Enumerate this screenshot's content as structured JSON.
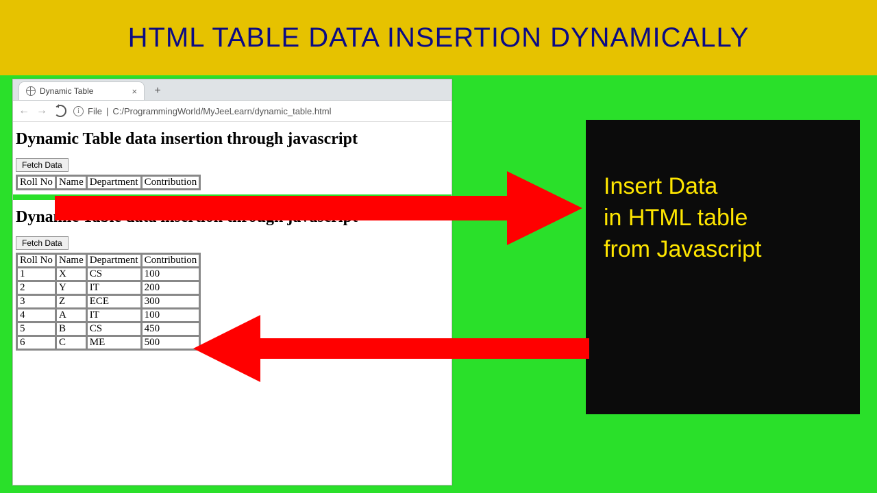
{
  "banner": {
    "title": "HTML TABLE DATA INSERTION DYNAMICALLY"
  },
  "browser": {
    "tab_title": "Dynamic Table",
    "url_scheme": "File",
    "url_path": "C:/ProgrammingWorld/MyJeeLearn/dynamic_table.html"
  },
  "page_top": {
    "heading": "Dynamic Table data insertion through javascript",
    "button": "Fetch Data",
    "headers": [
      "Roll No",
      "Name",
      "Department",
      "Contribution"
    ]
  },
  "page_bottom": {
    "heading": "Dynamic Table data insertion through javascript",
    "button": "Fetch Data",
    "headers": [
      "Roll No",
      "Name",
      "Department",
      "Contribution"
    ],
    "rows": [
      [
        "1",
        "X",
        "CS",
        "100"
      ],
      [
        "2",
        "Y",
        "IT",
        "200"
      ],
      [
        "3",
        "Z",
        "ECE",
        "300"
      ],
      [
        "4",
        "A",
        "IT",
        "100"
      ],
      [
        "5",
        "B",
        "CS",
        "450"
      ],
      [
        "6",
        "C",
        "ME",
        "500"
      ]
    ]
  },
  "panel": {
    "line1": "Insert Data",
    "line2": "in HTML table",
    "line3": "from Javascript"
  },
  "colors": {
    "banner": "#e6c200",
    "bg": "#2ae02a",
    "arrow": "#ff0000",
    "panel_bg": "#0b0b0b",
    "panel_text": "#ffe600",
    "title_text": "#0b0b84"
  }
}
